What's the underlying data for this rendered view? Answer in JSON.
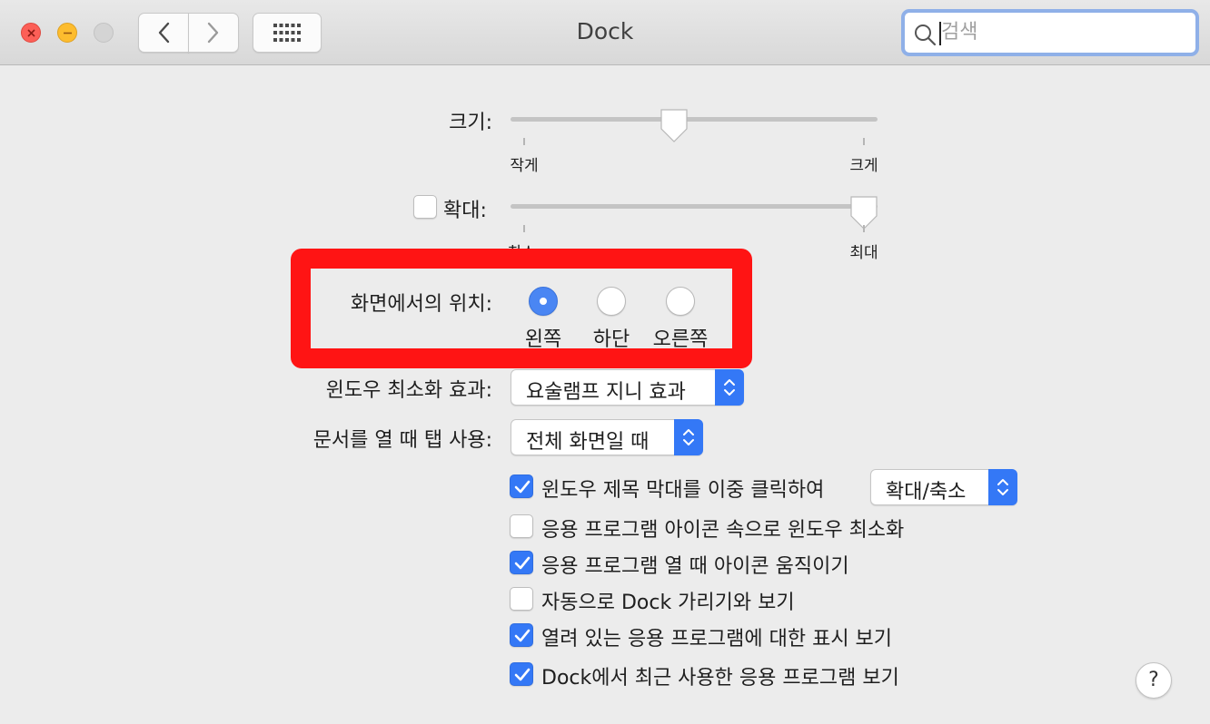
{
  "window": {
    "title": "Dock"
  },
  "search": {
    "placeholder": "검색"
  },
  "size": {
    "label": "크기:",
    "min_label": "작게",
    "max_label": "크게",
    "value_fraction": 0.44
  },
  "magnification": {
    "checked": false,
    "label": "확대:",
    "min_label": "최소",
    "max_label": "최대",
    "value_fraction": 1.0
  },
  "position": {
    "label": "화면에서의 위치:",
    "options": [
      {
        "label": "왼쪽",
        "selected": true
      },
      {
        "label": "하단",
        "selected": false
      },
      {
        "label": "오른쪽",
        "selected": false
      }
    ]
  },
  "minimize_effect": {
    "label": "윈도우 최소화 효과:",
    "value": "요술램프 지니 효과"
  },
  "prefer_tabs": {
    "label": "문서를 열 때 탭 사용:",
    "value": "전체 화면일 때"
  },
  "options": [
    {
      "label": "윈도우 제목 막대를 이중 클릭하여",
      "checked": true,
      "popup_value": "확대/축소"
    },
    {
      "label": "응용 프로그램 아이콘 속으로 윈도우 최소화",
      "checked": false
    },
    {
      "label": "응용 프로그램 열 때 아이콘 움직이기",
      "checked": true
    },
    {
      "label": "자동으로 Dock 가리기와 보기",
      "checked": false
    },
    {
      "label": "열려 있는 응용 프로그램에 대한 표시 보기",
      "checked": true
    },
    {
      "label": "Dock에서 최근 사용한 응용 프로그램 보기",
      "checked": true
    }
  ],
  "help": {
    "label": "?"
  },
  "colors": {
    "accent": "#3478f6",
    "highlight": "#ff1414"
  }
}
